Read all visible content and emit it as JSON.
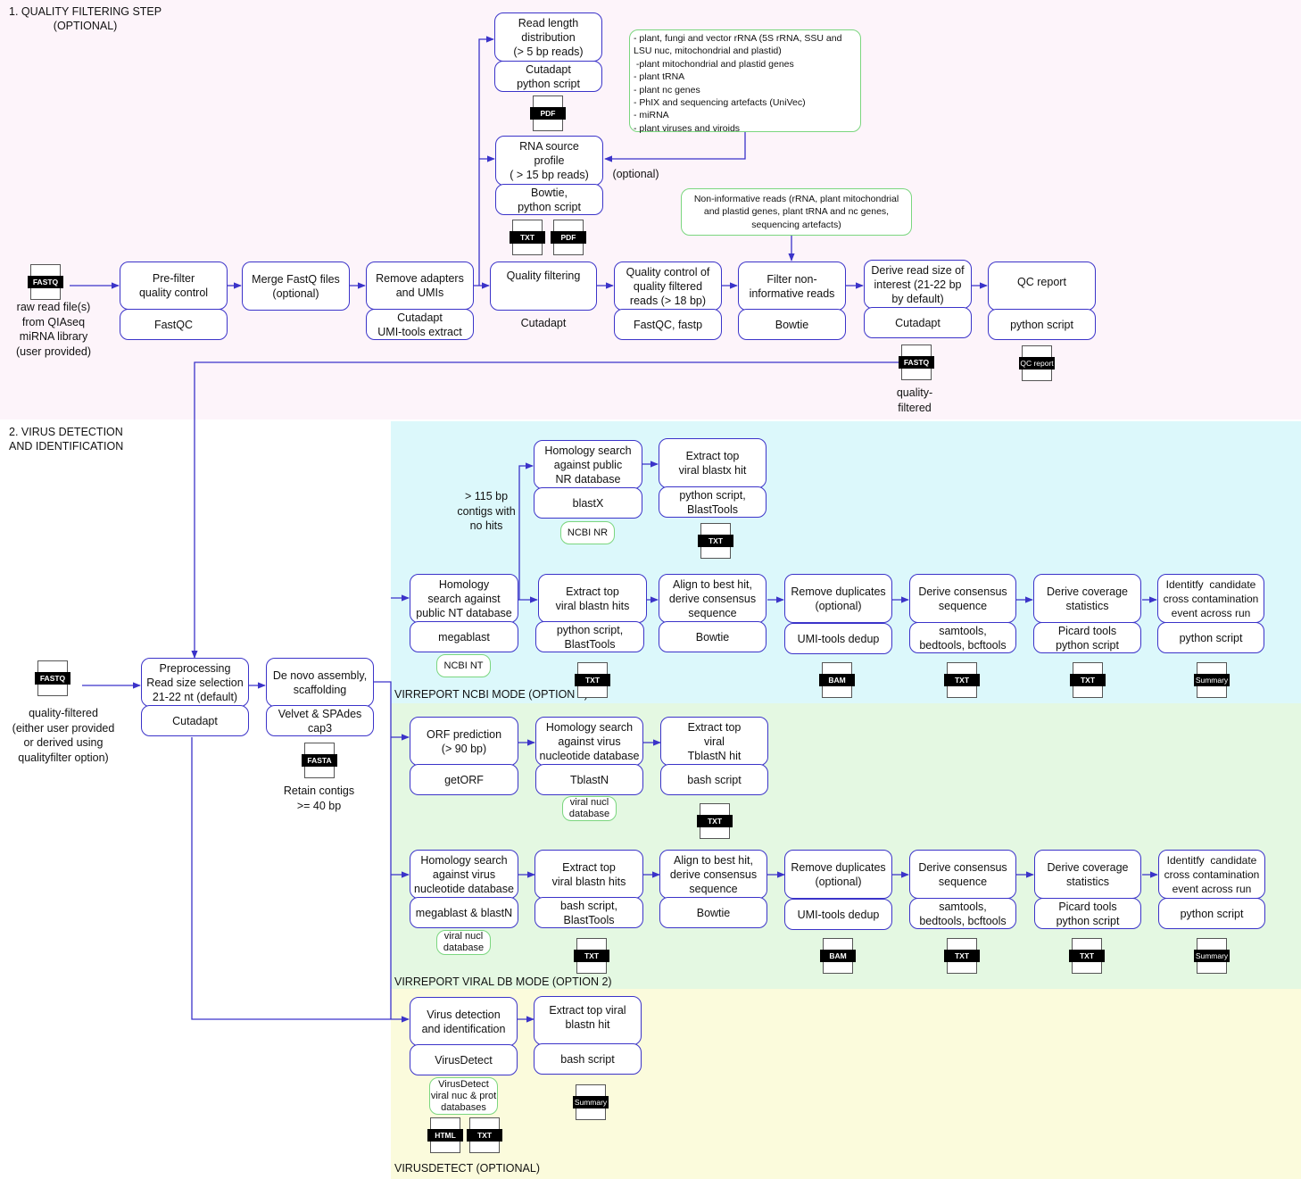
{
  "colors": {
    "edge": "#3b33c9",
    "node_border": "#3b33c9",
    "db_border": "#7bd67f",
    "bg_quality_filtering": "#fdf4fa",
    "bg_ncbi_mode": "#dcf8fb",
    "bg_viral_db_mode": "#e4f8e2",
    "bg_virusdetect": "#fbfbdc"
  },
  "sections": {
    "quality_filtering": "1. QUALITY FILTERING STEP\n(OPTIONAL)",
    "virus_detection": "2. VIRUS DETECTION\nAND IDENTIFICATION",
    "ncbi_mode": "VIRREPORT NCBI MODE (OPTION 1)",
    "viral_db_mode": "VIRREPORT VIRAL DB MODE (OPTION 2)",
    "virusdetect": "VIRUSDETECT (OPTIONAL)"
  },
  "qf": {
    "input_file": "FASTQ",
    "input_caption": "raw read file(s)\nfrom QIAseq\nmiRNA library\n(user provided)",
    "prefilter": {
      "step": "Pre-filter\nquality control",
      "tool": "FastQC"
    },
    "merge": {
      "step": "Merge FastQ files\n(optional)"
    },
    "adapters": {
      "step": "Remove adapters\nand UMIs",
      "tool": "Cutadapt\nUMI-tools extract"
    },
    "read_length": {
      "step": "Read length\ndistribution\n(> 5 bp reads)",
      "tool": "Cutadapt\npython script",
      "outputs": [
        "PDF"
      ]
    },
    "rna_source": {
      "step": "RNA source\nprofile\n( > 15 bp reads)",
      "tool": "Bowtie,\npython script",
      "outputs": [
        "TXT",
        "PDF"
      ],
      "note": "(optional)"
    },
    "rna_source_db": [
      "- plant, fungi and vector rRNA (5S rRNA, SSU and",
      "LSU nuc, mitochondrial and plastid)",
      " -plant mitochondrial and plastid genes",
      "- plant tRNA",
      "- plant nc genes",
      "- PhIX and sequencing artefacts (UniVec)",
      "- miRNA",
      "- plant viruses and viroids"
    ],
    "noninformative_db": "Non-informative reads (rRNA, plant mitochondrial\nand plastid genes, plant tRNA and nc genes,\nsequencing artefacts)",
    "quality_filtering": {
      "step": "Quality filtering",
      "tool": "Cutadapt"
    },
    "qc_filtered": {
      "step": "Quality control of\nquality filtered\nreads (> 18 bp)",
      "tool": "FastQC, fastp"
    },
    "filter_noninf": {
      "step": "Filter non-\ninformative reads",
      "tool": "Bowtie"
    },
    "derive_size": {
      "step": "Derive read size of\ninterest (21-22 bp\nby default)",
      "tool": "Cutadapt",
      "output": "FASTQ",
      "output_caption": "quality-\nfiltered"
    },
    "qc_report": {
      "step": "QC report",
      "tool": "python script",
      "output": "QC report"
    }
  },
  "vd": {
    "input_file": "FASTQ",
    "input_caption": "quality-filtered\n(either user provided\nor derived using\nqualityfilter option)",
    "preprocessing": {
      "step": "Preprocessing\nRead size selection\n21-22 nt (default)",
      "tool": "Cutadapt"
    },
    "assembly": {
      "step": "De novo assembly,\nscaffolding",
      "tool": "Velvet & SPAdes\ncap3",
      "output": "FASTA",
      "output_caption": "Retain contigs\n>= 40 bp"
    },
    "ncbi": {
      "nt_search": {
        "step": "Homology\nsearch against\npublic NT database",
        "tool": "megablast",
        "db": "NCBI NT"
      },
      "no_hits_label": "> 115 bp\ncontigs with\nno hits",
      "nr_search": {
        "step": "Homology search\nagainst public\nNR database",
        "tool": "blastX",
        "db": "NCBI NR"
      },
      "extract_blastx": {
        "step": "Extract top\nviral blastx hit",
        "tool": "python script,\nBlastTools",
        "output": "TXT"
      },
      "extract_blastn": {
        "step": "Extract top\nviral blastn hits",
        "tool": "python script,\nBlastTools",
        "output": "TXT"
      },
      "align": {
        "step": "Align to best hit,\nderive consensus\nsequence",
        "tool": "Bowtie"
      },
      "dedup": {
        "step": "Remove duplicates\n(optional)",
        "tool": "UMI-tools dedup",
        "output": "BAM"
      },
      "consensus": {
        "step": "Derive consensus\nsequence",
        "tool": "samtools,\nbedtools, bcftools",
        "output": "TXT"
      },
      "coverage": {
        "step": "Derive coverage\nstatistics",
        "tool": "Picard tools\npython script",
        "output": "TXT"
      },
      "crosscont": {
        "step": "Identitfy  candidate\ncross contamination\nevent across run",
        "tool": "python script",
        "output": "Summary"
      }
    },
    "viral": {
      "orf": {
        "step": "ORF prediction\n(> 90 bp)",
        "tool": "getORF"
      },
      "tblastn_search": {
        "step": "Homology search\nagainst virus\nnucleotide database",
        "tool": "TblastN",
        "db": "viral nucl\ndatabase"
      },
      "extract_tblastn": {
        "step": "Extract top\nviral\nTblastN hit",
        "tool": "bash script",
        "output": "TXT"
      },
      "blastn_search": {
        "step": "Homology search\nagainst virus\nnucleotide database",
        "tool": "megablast & blastN",
        "db": "viral nucl\ndatabase"
      },
      "extract_blastn": {
        "step": "Extract top\nviral blastn hits",
        "tool": "bash script,\nBlastTools",
        "output": "TXT"
      },
      "align": {
        "step": "Align to best hit,\nderive consensus\nsequence",
        "tool": "Bowtie"
      },
      "dedup": {
        "step": "Remove duplicates\n(optional)",
        "tool": "UMI-tools dedup",
        "output": "BAM"
      },
      "consensus": {
        "step": "Derive consensus\nsequence",
        "tool": "samtools,\nbedtools, bcftools",
        "output": "TXT"
      },
      "coverage": {
        "step": "Derive coverage\nstatistics",
        "tool": "Picard tools\npython script",
        "output": "TXT"
      },
      "crosscont": {
        "step": "Identitfy  candidate\ncross contamination\nevent across run",
        "tool": "python script",
        "output": "Summary"
      }
    },
    "virusdetect": {
      "detect": {
        "step": "Virus detection\nand identification",
        "tool": "VirusDetect",
        "db": "VirusDetect\nviral nuc & prot\ndatabases",
        "outputs": [
          "HTML",
          "TXT"
        ]
      },
      "extract": {
        "step": "Extract top viral\nblastn hit",
        "tool": "bash script",
        "output": "Summary"
      }
    }
  }
}
